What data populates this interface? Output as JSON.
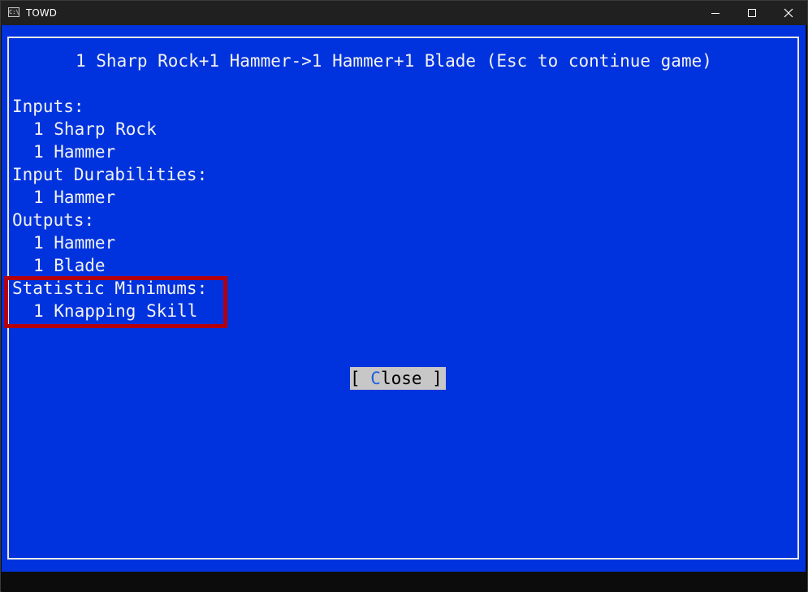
{
  "window": {
    "title": "TOWD",
    "icon_text": "C:\\",
    "controls": [
      "minimize-icon",
      "maximize-icon",
      "close-icon"
    ]
  },
  "dialog": {
    "title": "1 Sharp Rock+1 Hammer->1 Hammer+1 Blade (Esc to continue game)",
    "sections": {
      "inputs_header": "Inputs:",
      "inputs": [
        "1 Sharp Rock",
        "1 Hammer"
      ],
      "durabilities_header": "Input Durabilities:",
      "durabilities": [
        "1 Hammer"
      ],
      "outputs_header": "Outputs:",
      "outputs": [
        "1 Hammer",
        "1 Blade"
      ],
      "stat_header": "Statistic Minimums:",
      "stats": [
        "1 Knapping Skill"
      ]
    },
    "close_button": {
      "prefix": "[ ",
      "hotkey": "C",
      "rest": "lose ]"
    }
  },
  "colors": {
    "console_background": "#0033dd",
    "text": "#f2f2f2",
    "highlight_border": "#b3000f",
    "button_background": "#c7c7c7",
    "hotkey": "#1b5fe0"
  }
}
